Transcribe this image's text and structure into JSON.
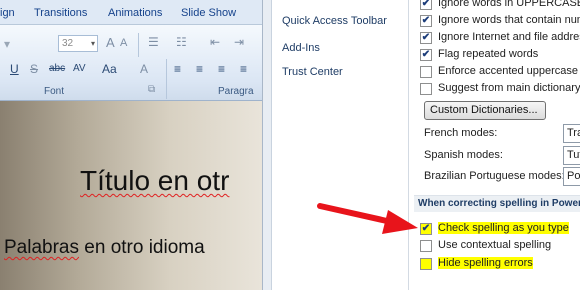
{
  "ribbon": {
    "tabs": [
      "ign",
      "Transitions",
      "Animations",
      "Slide Show"
    ],
    "font_size_value": "32",
    "groups": {
      "font": "Font",
      "paragraph": "Paragra"
    },
    "buttons": [
      "A",
      "A",
      "U",
      "S",
      "abc",
      "AV",
      "Aa",
      "A"
    ]
  },
  "slide": {
    "title": "Título en otr",
    "body_word1": "Palabras",
    "body_rest": "en otro idioma"
  },
  "options_nav": {
    "items": [
      "Quick Access Toolbar",
      "Add-Ins",
      "Trust Center"
    ]
  },
  "proofing": {
    "ignore_uppercase": {
      "label": "Ignore words in UPPERCASE",
      "checked": true
    },
    "ignore_numbers": {
      "label": "Ignore words that contain num",
      "checked": true
    },
    "ignore_internet": {
      "label": "Ignore Internet and file addres",
      "checked": true
    },
    "flag_repeated": {
      "label": "Flag repeated words",
      "checked": true
    },
    "enforce_accented": {
      "label": "Enforce accented uppercase in",
      "checked": false
    },
    "suggest_main": {
      "label": "Suggest from main dictionary o",
      "checked": false
    },
    "custom_dictionaries": "Custom Dictionaries...",
    "modes": [
      {
        "label": "French modes:",
        "value": "Tra"
      },
      {
        "label": "Spanish modes:",
        "value": "Tut"
      },
      {
        "label": "Brazilian Portuguese modes:",
        "value": "Pos"
      }
    ],
    "section_header": "When correcting spelling in PowerP",
    "check_spelling": {
      "label": "Check spelling as you type",
      "checked": true
    },
    "use_contextual": {
      "label": "Use contextual spelling",
      "checked": false
    },
    "hide_spelling": {
      "label": "Hide spelling errors",
      "checked": false
    },
    "check_mark": "✔"
  },
  "colors": {
    "highlight": "#ffff00",
    "arrow": "#e8141b",
    "ribbon_text": "#15428b"
  },
  "annotation": {
    "icon": "red-arrow-icon"
  }
}
